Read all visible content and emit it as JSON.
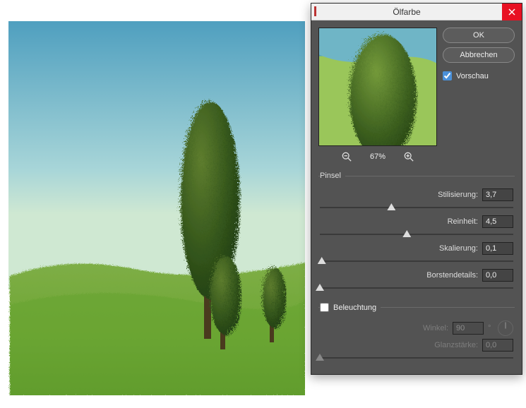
{
  "dialog": {
    "title": "Ölfarbe",
    "ok": "OK",
    "cancel": "Abbrechen",
    "preview_label": "Vorschau",
    "preview_checked": true,
    "zoom": "67%"
  },
  "brush_group": {
    "legend": "Pinsel",
    "params": {
      "stilisierung": {
        "label": "Stilisierung:",
        "value": "3,7",
        "pos": 37
      },
      "reinheit": {
        "label": "Reinheit:",
        "value": "4,5",
        "pos": 45
      },
      "skalierung": {
        "label": "Skalierung:",
        "value": "0,1",
        "pos": 1
      },
      "borsten": {
        "label": "Borstendetails:",
        "value": "0,0",
        "pos": 0
      }
    }
  },
  "light_group": {
    "legend": "Beleuchtung",
    "enabled": false,
    "params": {
      "winkel": {
        "label": "Winkel:",
        "value": "90",
        "unit": "°"
      },
      "glanzstaerke": {
        "label": "Glanzstärke:",
        "value": "0,0",
        "pos": 0
      }
    }
  }
}
